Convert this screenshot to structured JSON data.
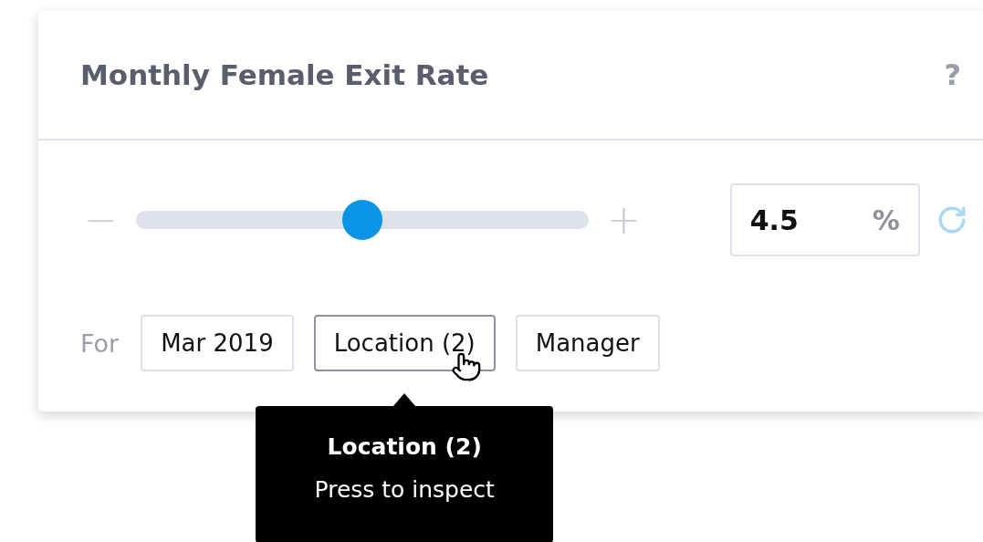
{
  "card": {
    "title": "Monthly Female Exit Rate",
    "help": "?"
  },
  "slider": {
    "minus": "−",
    "plus": "+",
    "level": 0.5
  },
  "value_field": {
    "value": "4.5",
    "unit": "%"
  },
  "filters": {
    "label": "For",
    "items": [
      {
        "label": "Mar 2019",
        "hovered": false
      },
      {
        "label": "Location (2)",
        "hovered": true
      },
      {
        "label": "Manager",
        "hovered": false
      }
    ]
  },
  "tooltip": {
    "title": "Location (2)",
    "text": "Press to inspect"
  }
}
